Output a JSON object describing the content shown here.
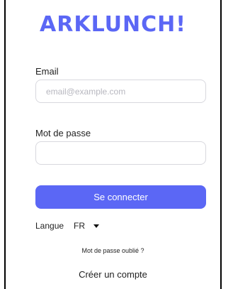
{
  "brand": {
    "logo_text": "ARKLUNCH!",
    "accent_color": "#5b67f5"
  },
  "form": {
    "email_label": "Email",
    "email_value": "",
    "email_placeholder": "email@example.com",
    "password_label": "Mot de passe",
    "password_value": "",
    "password_placeholder": "",
    "submit_label": "Se connecter"
  },
  "language": {
    "label": "Langue",
    "selected": "FR",
    "dropdown_icon": "caret-down-icon"
  },
  "links": {
    "forgot_password": "Mot de passe oublié ?",
    "create_account": "Créer un compte"
  }
}
